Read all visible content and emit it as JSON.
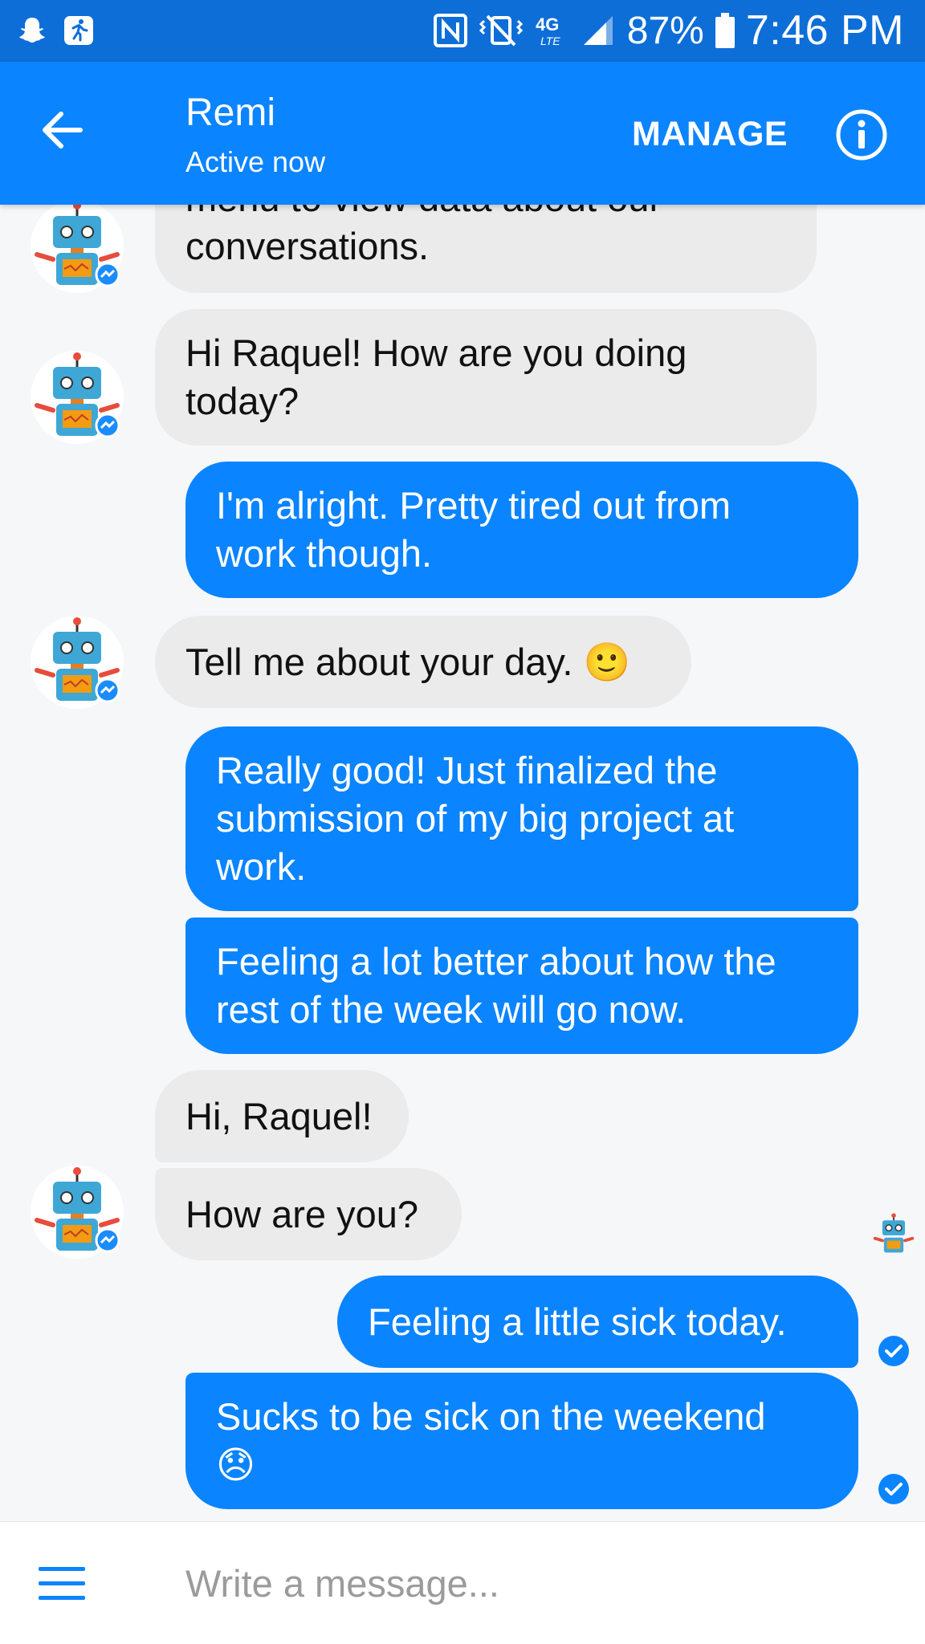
{
  "status_bar": {
    "battery_percent": "87%",
    "time": "7:46 PM",
    "network": "4G LTE",
    "icons": [
      "snapchat-icon",
      "fitness-icon",
      "nfc-icon",
      "vibrate-icon",
      "network-4g-icon",
      "signal-icon",
      "battery-icon"
    ]
  },
  "header": {
    "title": "Remi",
    "subtitle": "Active now",
    "manage_label": "MANAGE",
    "back_icon": "back-arrow-icon",
    "info_icon": "info-icon"
  },
  "colors": {
    "brand": "#0b84ff",
    "status_bar": "#0d6ed8",
    "incoming_bubble": "#ebebeb",
    "outgoing_bubble": "#0b84ff"
  },
  "messages": [
    {
      "from": "bot",
      "text_lines": [
        "menu to view data about our",
        "conversations."
      ]
    },
    {
      "from": "bot",
      "text_lines": [
        "Hi Raquel! How are you doing",
        "today?"
      ]
    },
    {
      "from": "user",
      "text_lines": [
        "I'm alright. Pretty tired out from",
        "work though."
      ]
    },
    {
      "from": "bot",
      "text": "Tell me about your day. 🙂"
    },
    {
      "from": "user",
      "text_lines": [
        "Really good! Just finalized the",
        "submission of my big project at",
        "work."
      ]
    },
    {
      "from": "user",
      "text_lines": [
        "Feeling a lot better about how the",
        "rest of the week will go now."
      ]
    },
    {
      "from": "bot",
      "text": "Hi, Raquel!"
    },
    {
      "from": "bot",
      "text": "How are you?"
    },
    {
      "from": "user",
      "text": "Feeling a little sick today."
    },
    {
      "from": "user",
      "text_lines": [
        "Sucks to be sick on the weekend",
        "😞"
      ]
    }
  ],
  "composer": {
    "placeholder": "Write a message...",
    "menu_icon": "hamburger-menu-icon"
  }
}
